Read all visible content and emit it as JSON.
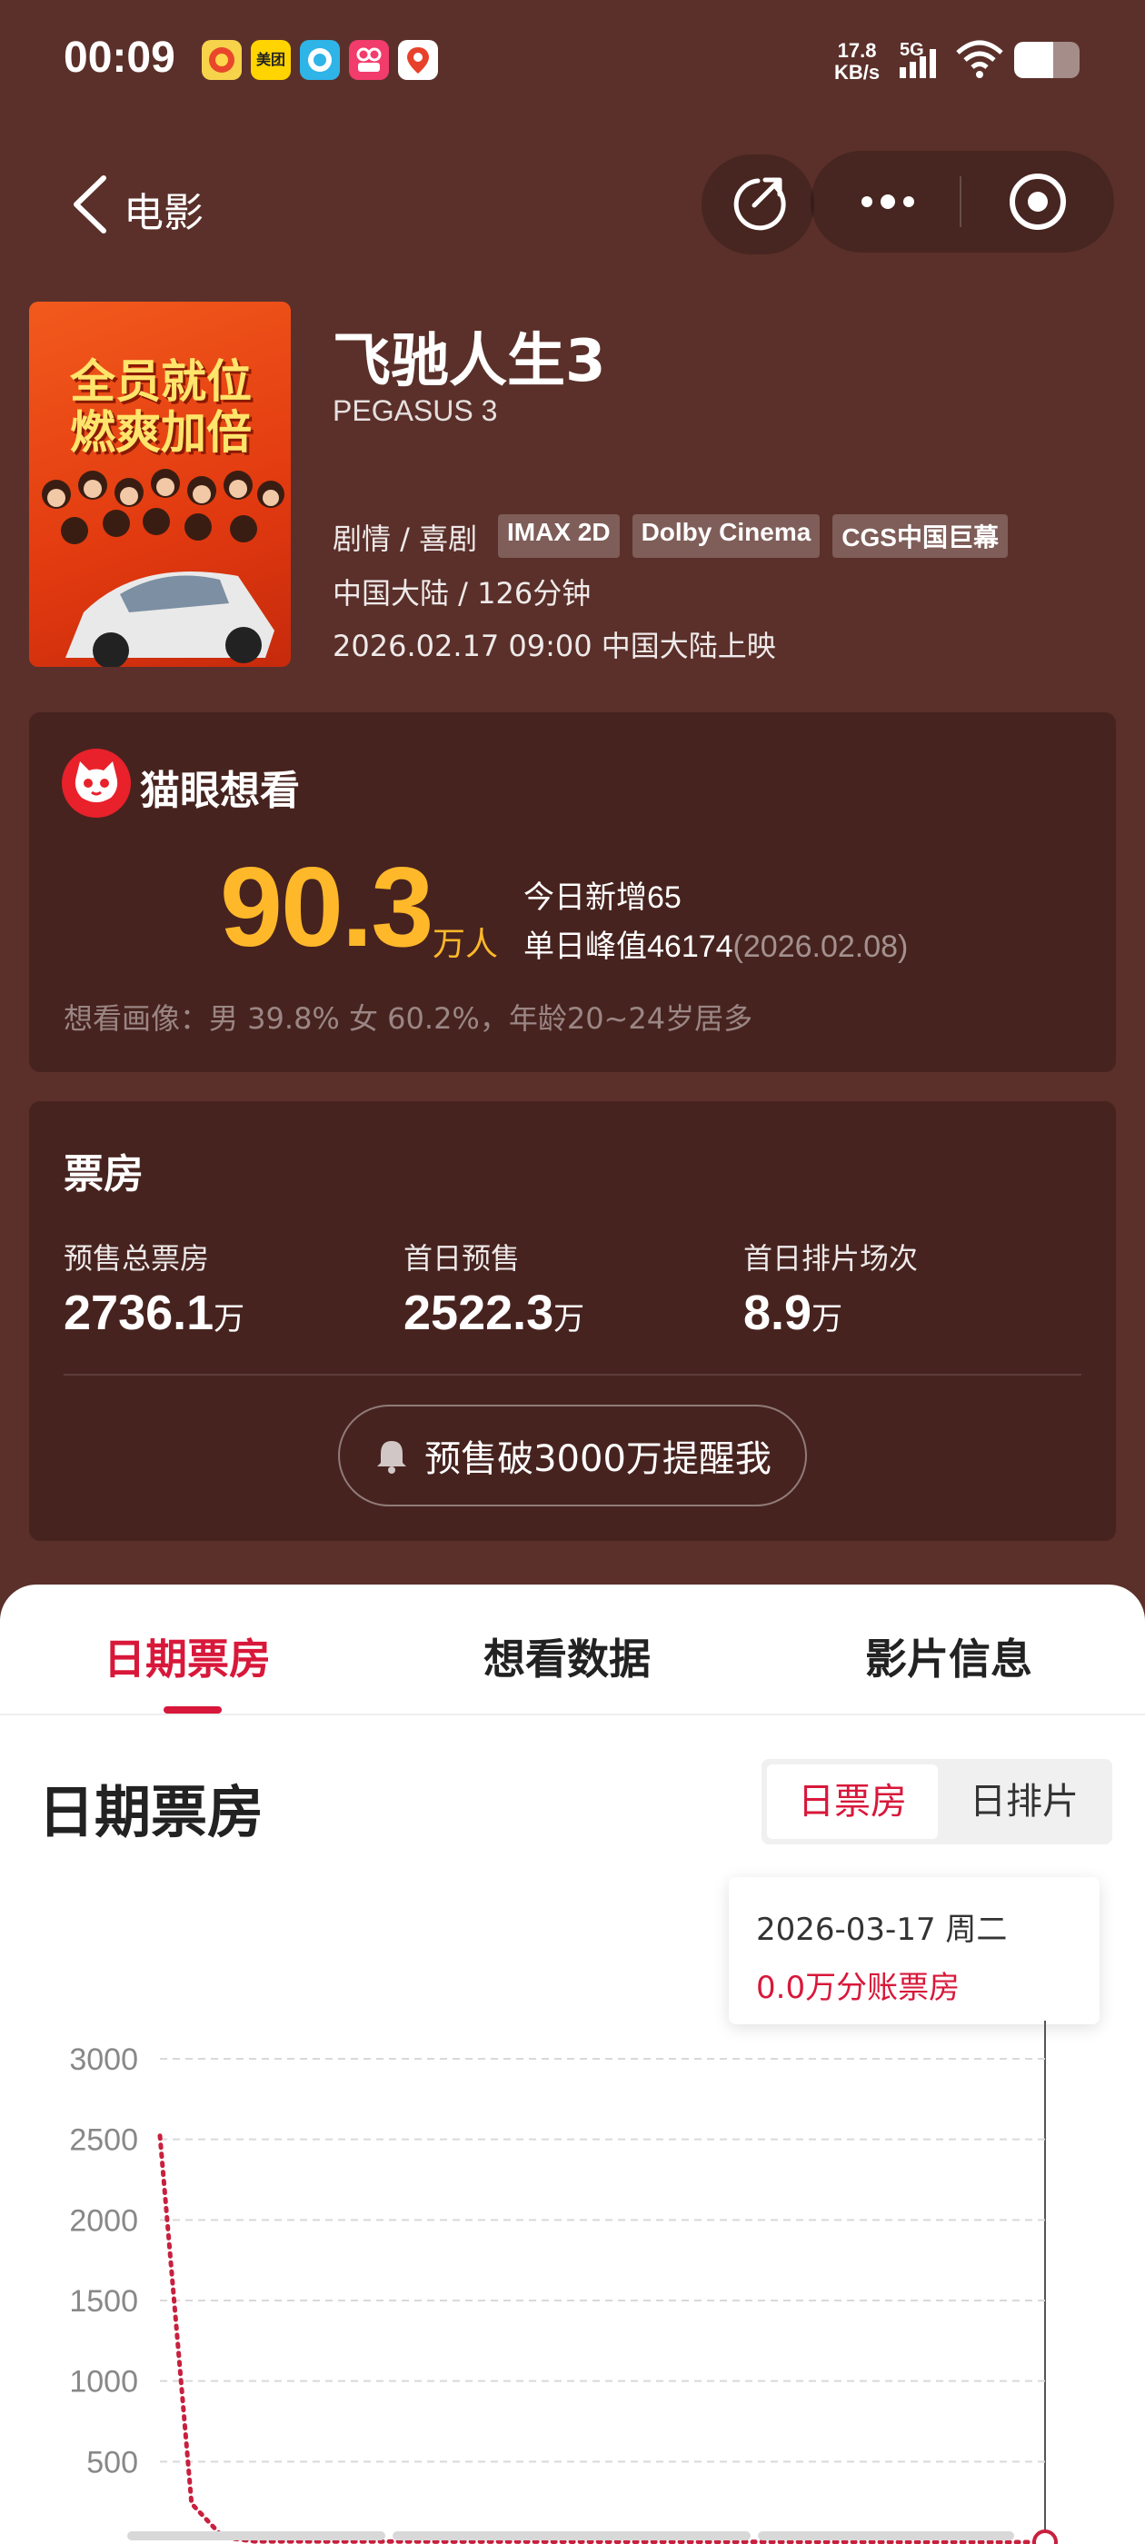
{
  "status_bar": {
    "time": "00:09",
    "speed_value": "17.8",
    "speed_unit": "KB/s",
    "network": "5G",
    "battery_level": 0.6,
    "app_icons": [
      "app-weather-icon",
      "meituan-icon",
      "camera-app-icon",
      "video-app-icon",
      "map-app-icon"
    ],
    "meituan_label": "美团"
  },
  "nav": {
    "back_label": "电影"
  },
  "movie": {
    "title": "飞驰人生3",
    "english_title": "PEGASUS 3",
    "genre": "剧情 / 喜剧",
    "tags": [
      "IMAX 2D",
      "Dolby Cinema",
      "CGS中国巨幕"
    ],
    "region_duration": "中国大陆 / 126分钟",
    "release": "2026.02.17 09:00 中国大陆上映",
    "poster_text": "全员就位\n燃爽加倍"
  },
  "want_to_see": {
    "brand": "猫眼想看",
    "count": "90.3",
    "unit": "万人",
    "today_label": "今日新增",
    "today_value": "65",
    "peak_label": "单日峰值",
    "peak_value": "46174",
    "peak_date": "(2026.02.08)",
    "portrait": "想看画像：男 39.8% 女 60.2%，年龄20~24岁居多"
  },
  "box_office": {
    "heading": "票房",
    "stats": [
      {
        "label": "预售总票房",
        "value": "2736.1",
        "unit": "万"
      },
      {
        "label": "首日预售",
        "value": "2522.3",
        "unit": "万"
      },
      {
        "label": "首日排片场次",
        "value": "8.9",
        "unit": "万"
      }
    ],
    "remind_label": "预售破3000万提醒我"
  },
  "tabs": [
    "日期票房",
    "想看数据",
    "影片信息"
  ],
  "active_tab": 0,
  "daily_section": {
    "title": "日期票房",
    "toggle": [
      "日票房",
      "日排片"
    ],
    "tooltip_date": "2026-03-17 周二",
    "tooltip_value": "0.0万分账票房"
  },
  "colors": {
    "background": "#5b302a",
    "card": "#47231f",
    "accent_gold": "#ffb829",
    "accent_red": "#d8183a"
  },
  "chart_data": {
    "type": "line",
    "y_ticks": [
      "3000",
      "2500",
      "2000",
      "1500",
      "1000",
      "500"
    ],
    "ylim": [
      0,
      3000
    ],
    "grid": true,
    "line_style": "dotted",
    "x": [
      0,
      1,
      2,
      3,
      28
    ],
    "values": [
      2522.3,
      240,
      30,
      5,
      0
    ],
    "xlabel": "",
    "ylabel": ""
  }
}
